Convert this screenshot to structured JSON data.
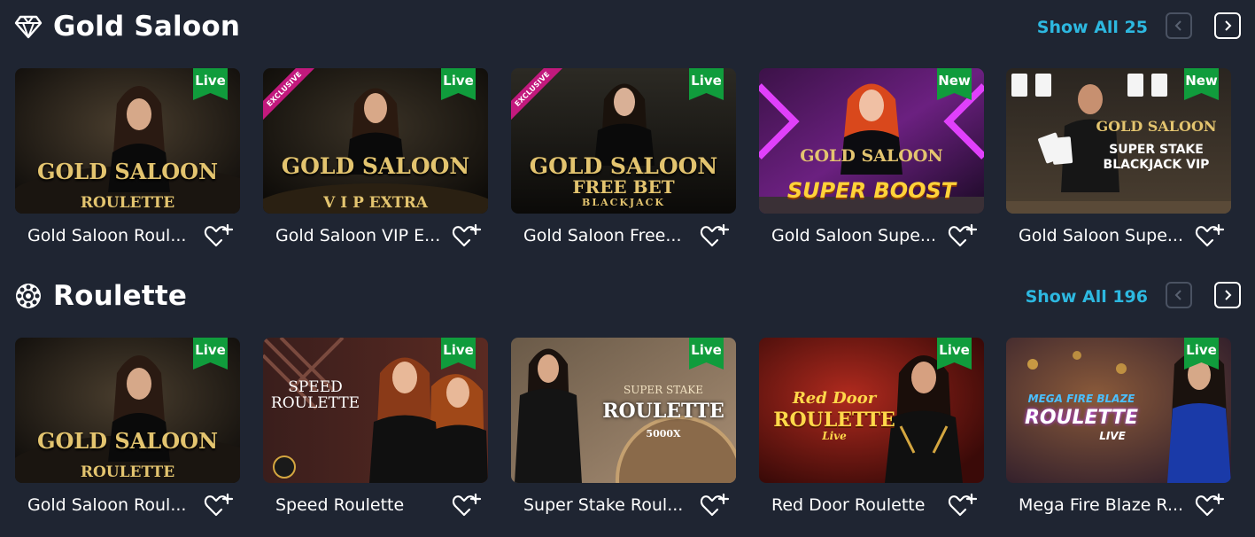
{
  "colors": {
    "background": "#1f2532",
    "accent": "#2db8e0",
    "badge_green": "#109c3c",
    "exclusive_pink": "#c2197d"
  },
  "sections": [
    {
      "title": "Gold Saloon",
      "icon": "diamond-icon",
      "show_all": "Show All 25",
      "games": [
        {
          "name": "Gold Saloon Roul...",
          "badge": "Live",
          "art": [
            "GOLD SALOON",
            "ROULETTE"
          ]
        },
        {
          "name": "Gold Saloon VIP E...",
          "badge": "Live",
          "exclusive": "EXCLUSIVE",
          "art": [
            "GOLD SALOON",
            "V I P EXTRA"
          ]
        },
        {
          "name": "Gold Saloon Free...",
          "badge": "Live",
          "exclusive": "EXCLUSIVE",
          "art": [
            "GOLD SALOON",
            "FREE BET",
            "BLACKJACK"
          ]
        },
        {
          "name": "Gold Saloon Supe...",
          "badge": "New",
          "art": [
            "GOLD SALOON",
            "SUPER BOOST"
          ]
        },
        {
          "name": "Gold Saloon Supe...",
          "badge": "New",
          "art": [
            "GOLD SALOON",
            "SUPER STAKE",
            "BLACKJACK VIP"
          ]
        }
      ]
    },
    {
      "title": "Roulette",
      "icon": "roulette-wheel-icon",
      "show_all": "Show All 196",
      "games": [
        {
          "name": "Gold Saloon Roul...",
          "badge": "Live",
          "art": [
            "GOLD SALOON",
            "ROULETTE"
          ]
        },
        {
          "name": "Speed Roulette",
          "badge": "Live",
          "art": [
            "SPEED",
            "ROULETTE"
          ]
        },
        {
          "name": "Super Stake Roul...",
          "badge": "Live",
          "art": [
            "SUPER STAKE",
            "ROULETTE",
            "5000X"
          ]
        },
        {
          "name": "Red Door Roulette",
          "badge": "Live",
          "art": [
            "Red Door",
            "ROULETTE",
            "Live"
          ]
        },
        {
          "name": "Mega Fire Blaze R...",
          "badge": "Live",
          "art": [
            "MEGA FIRE BLAZE",
            "ROULETTE",
            "LIVE"
          ]
        }
      ]
    }
  ]
}
